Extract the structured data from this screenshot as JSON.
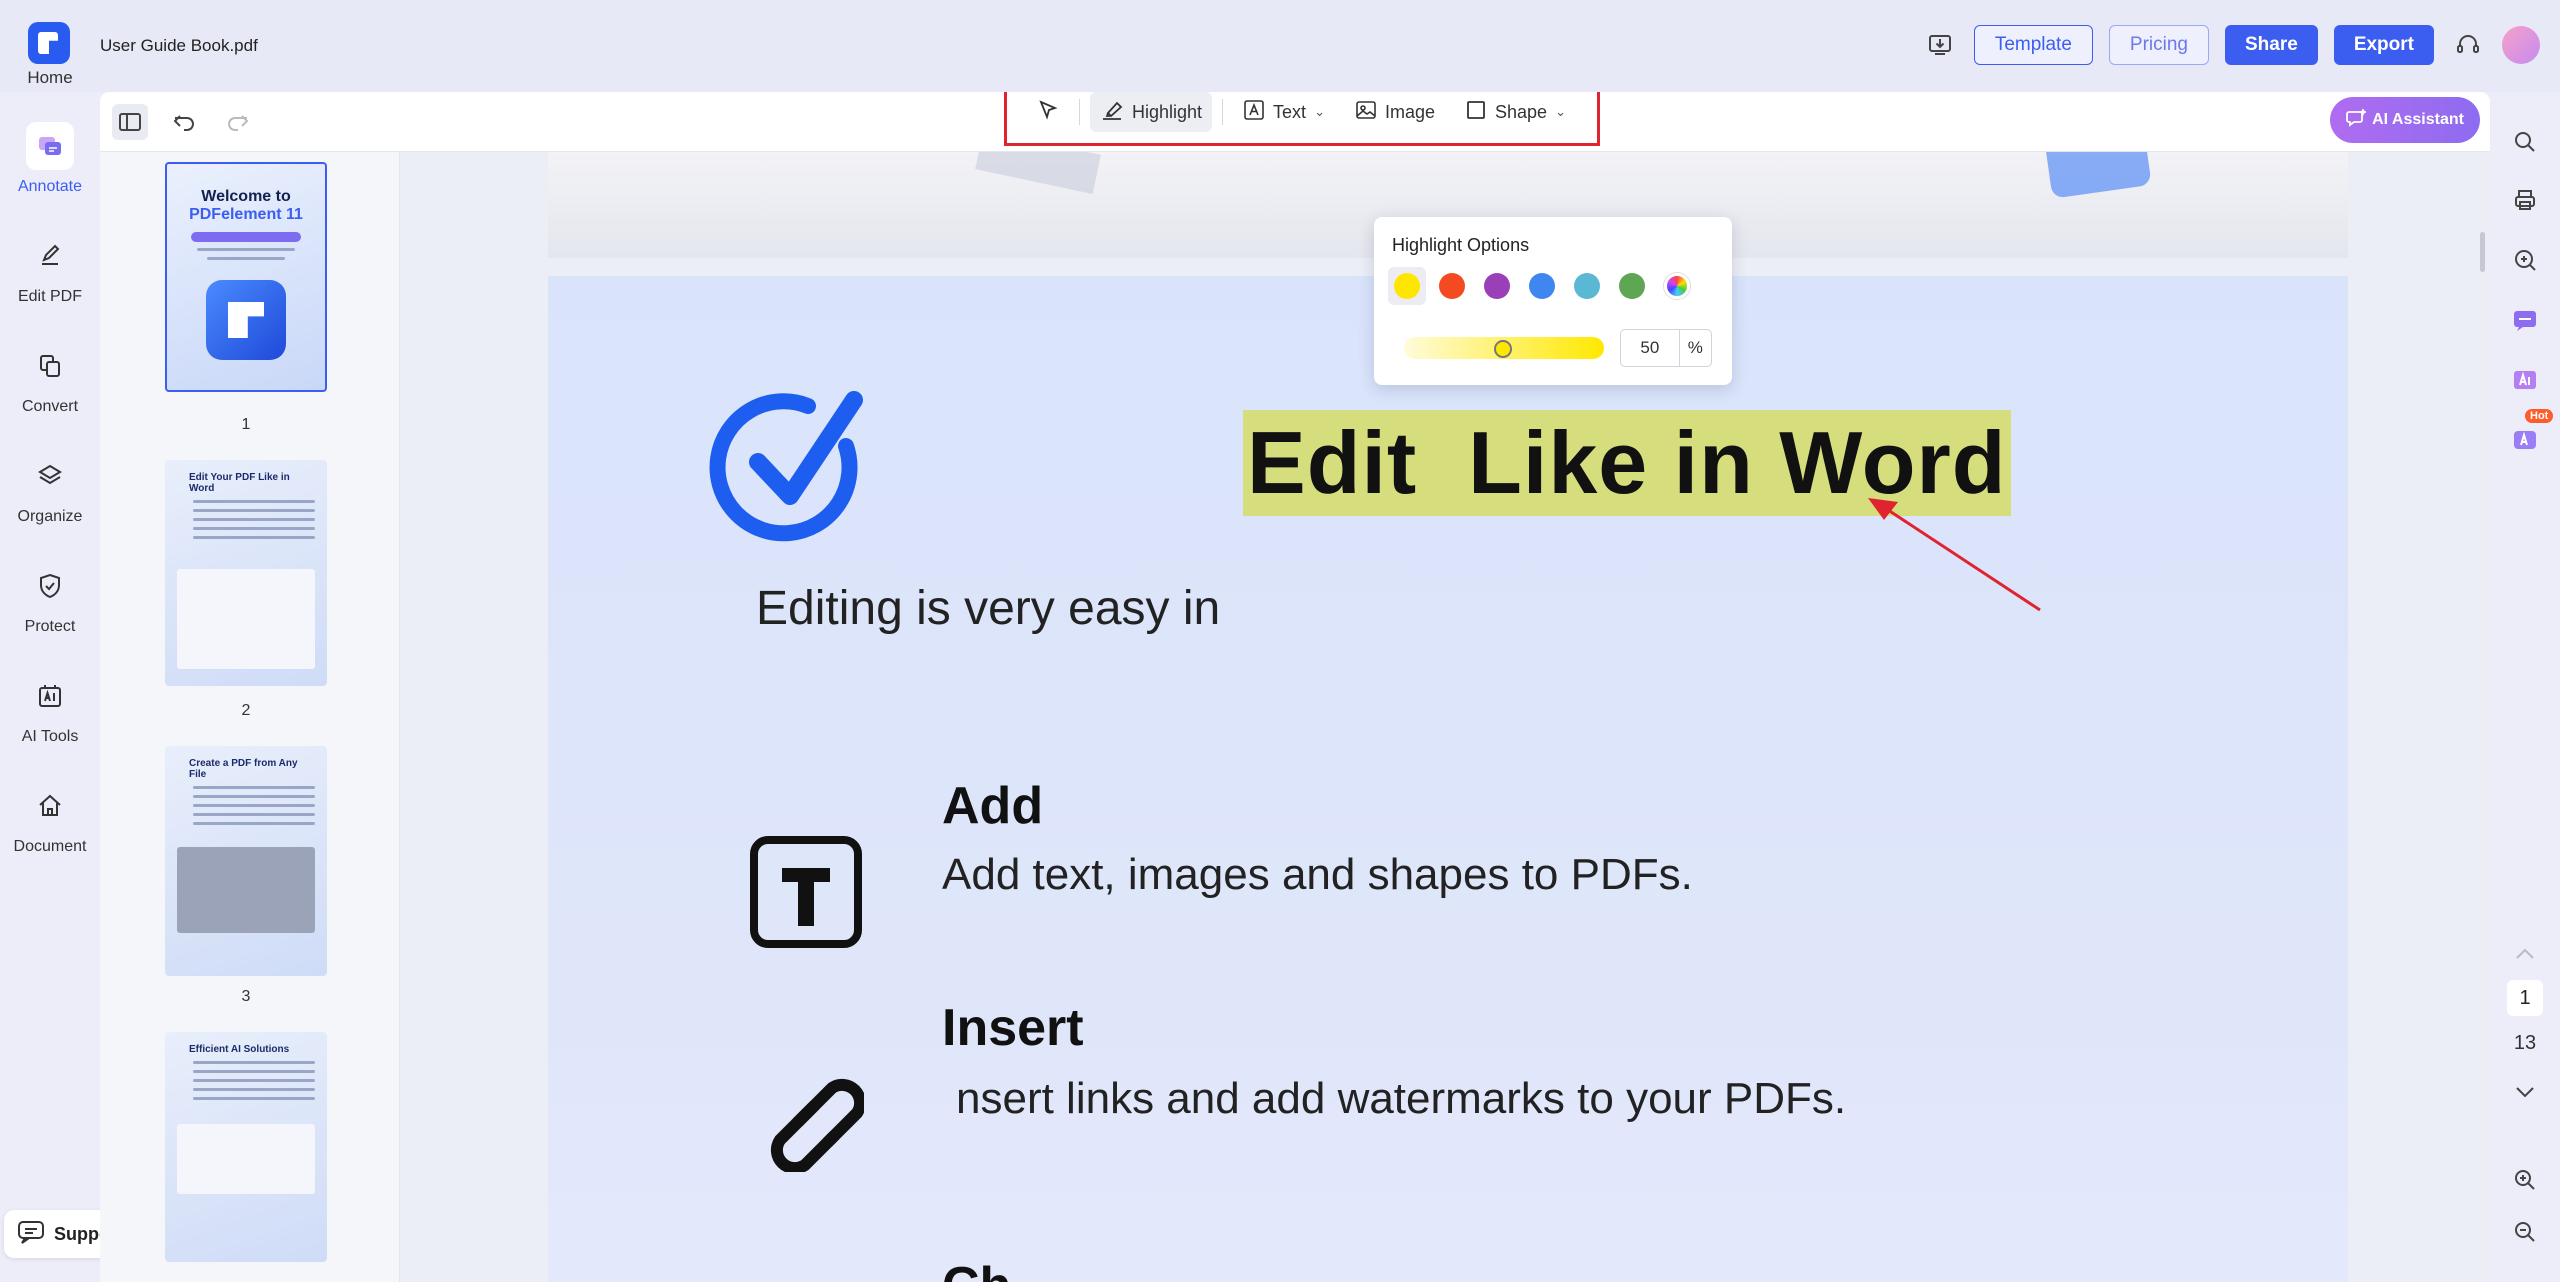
{
  "app": {
    "home_label": "Home",
    "file_title": "User Guide Book.pdf"
  },
  "topbar": {
    "template_label": "Template",
    "pricing_label": "Pricing",
    "share_label": "Share",
    "export_label": "Export"
  },
  "leftnav": [
    {
      "label": "Annotate",
      "icon": "annotate-icon"
    },
    {
      "label": "Edit PDF",
      "icon": "edit-icon"
    },
    {
      "label": "Convert",
      "icon": "convert-icon"
    },
    {
      "label": "Organize",
      "icon": "layers-icon"
    },
    {
      "label": "Protect",
      "icon": "shield-icon"
    },
    {
      "label": "AI Tools",
      "icon": "ai-icon"
    },
    {
      "label": "Document",
      "icon": "house-icon"
    }
  ],
  "support_label": "Support",
  "toolbar": {
    "highlight_label": "Highlight",
    "text_label": "Text",
    "image_label": "Image",
    "shape_label": "Shape",
    "ai_assistant_label": "AI Assistant"
  },
  "highlight_options": {
    "title": "Highlight Options",
    "colors": [
      "#ffe600",
      "#f44a22",
      "#9b3fb8",
      "#3f86f0",
      "#5ab8d4",
      "#5fa654"
    ],
    "selected_color": "#ffe600",
    "opacity_value": "50",
    "opacity_unit": "%"
  },
  "thumbnails": {
    "pages": [
      {
        "number": "1",
        "welcome": "Welcome to",
        "product": "PDFelement 11"
      },
      {
        "number": "2",
        "heading": "Edit Your PDF Like in Word"
      },
      {
        "number": "3",
        "heading": "Create a PDF from Any File"
      },
      {
        "number": "",
        "heading": "Efficient AI Solutions"
      }
    ]
  },
  "document": {
    "title_part1": "Edit",
    "title_part2": "Like in Word",
    "subtitle": "Editing is very easy in",
    "sections": [
      {
        "title": "Add",
        "desc": "Add text, images and shapes to PDFs."
      },
      {
        "title": "Insert",
        "desc": "nsert links and add watermarks to your PDFs."
      }
    ]
  },
  "pager": {
    "current": "1",
    "total": "13"
  },
  "hot_badge": "Hot"
}
